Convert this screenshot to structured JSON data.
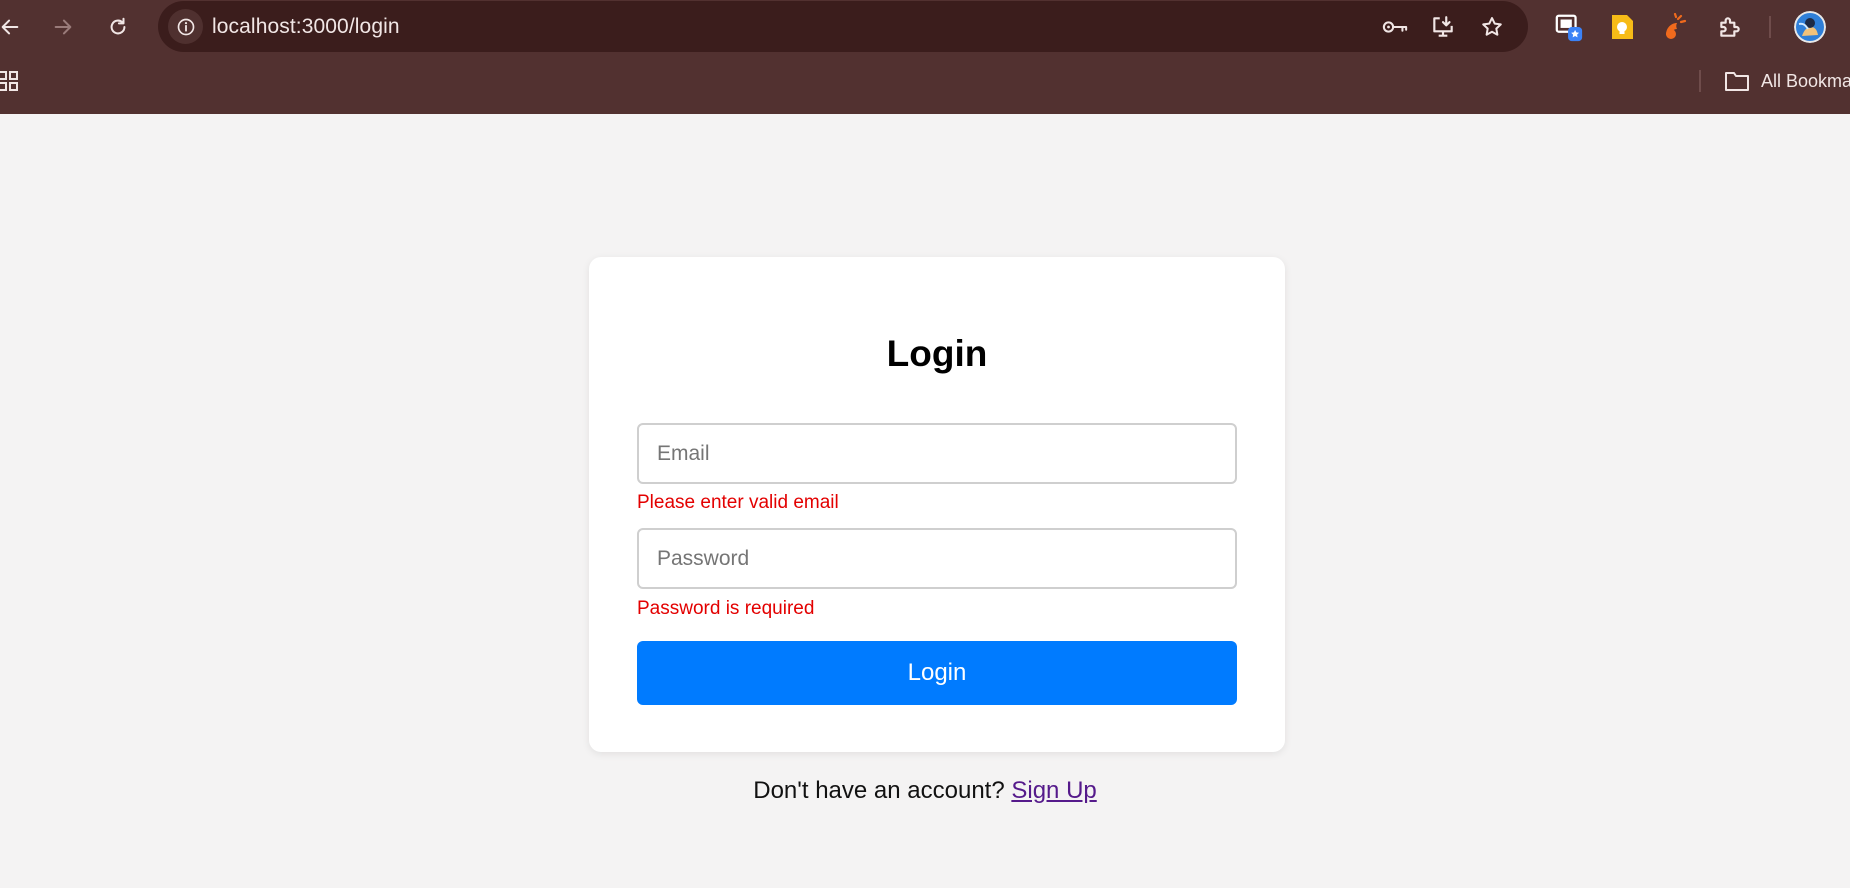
{
  "browser": {
    "url": "localhost:3000/login",
    "bookmarks_label": "All Bookma",
    "icons": [
      "back-icon",
      "forward-icon",
      "reload-icon",
      "site-info-icon",
      "password-key-icon",
      "install-app-icon",
      "bookmark-star-icon",
      "tab-search-extension-icon",
      "keep-extension-icon",
      "orange-extension-icon",
      "extensions-puzzle-icon",
      "profile-avatar",
      "apps-grid-icon",
      "folder-icon"
    ],
    "colors": {
      "frame": "#523130",
      "omnibox": "#3b1d1c"
    }
  },
  "login": {
    "title": "Login",
    "email_placeholder": "Email",
    "email_value": "",
    "email_error": "Please enter valid email",
    "password_placeholder": "Password",
    "password_value": "",
    "password_error": "Password is required",
    "submit_label": "Login"
  },
  "footer": {
    "prompt": "Don't have an account?",
    "signup_label": "Sign Up"
  },
  "colors": {
    "page_bg": "#f4f3f3",
    "primary": "#007bff",
    "error": "#e30000",
    "link_visited": "#551a8b"
  }
}
